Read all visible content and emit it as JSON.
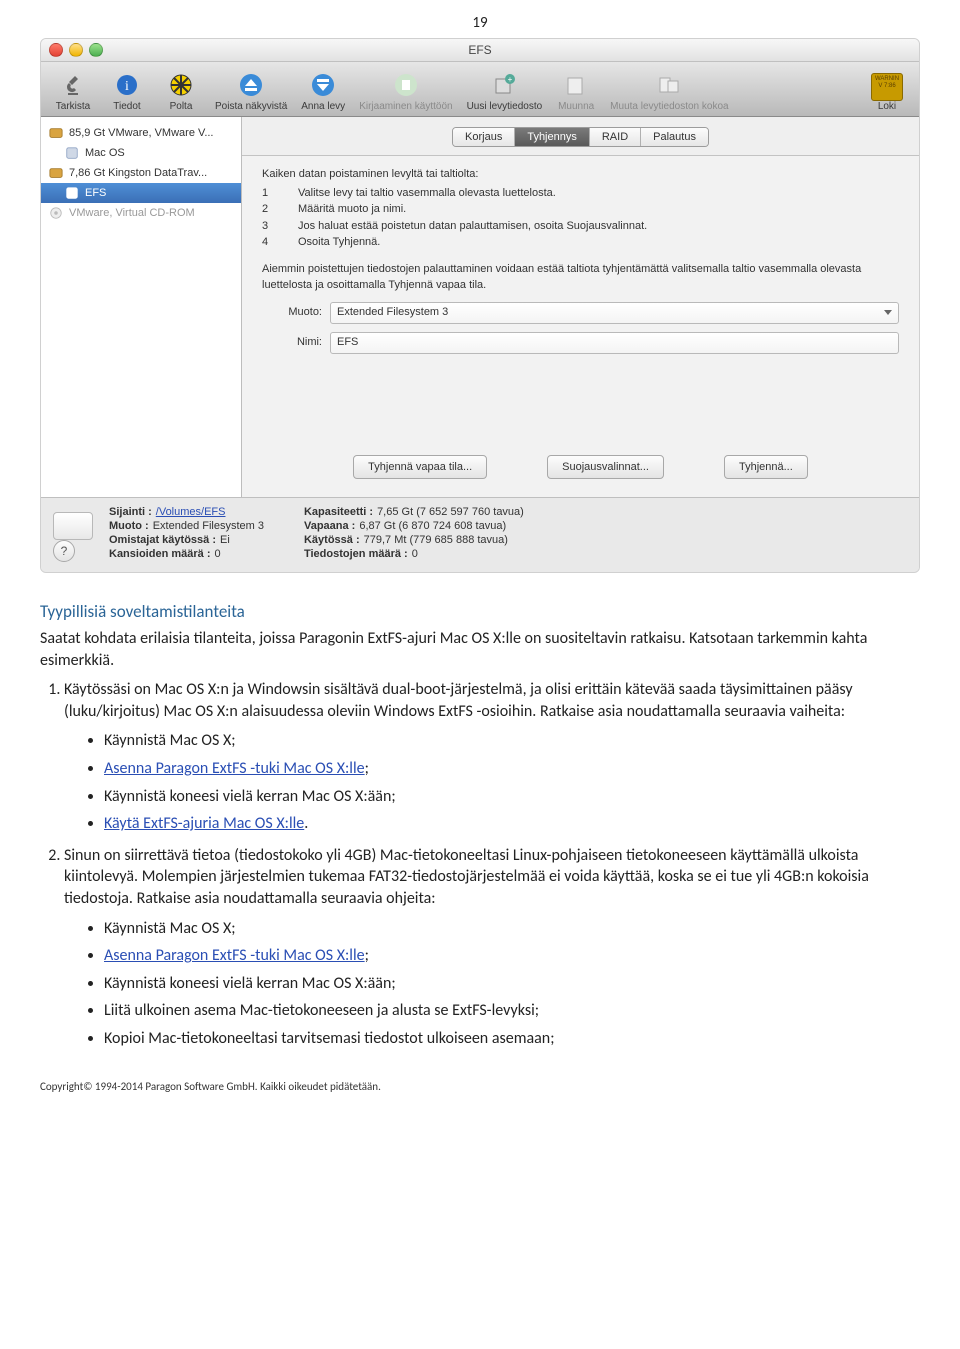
{
  "page_number": "19",
  "screenshot": {
    "window_title": "EFS",
    "toolbar": [
      {
        "label": "Tarkista",
        "dim": false
      },
      {
        "label": "Tiedot",
        "dim": false
      },
      {
        "label": "Polta",
        "dim": false
      },
      {
        "label": "Poista näkyvistä",
        "dim": false
      },
      {
        "label": "Anna levy",
        "dim": false
      },
      {
        "label": "Kirjaaminen käyttöön",
        "dim": true
      },
      {
        "label": "Uusi levytiedosto",
        "dim": false
      },
      {
        "label": "Muunna",
        "dim": true
      },
      {
        "label": "Muuta levytiedoston kokoa",
        "dim": true
      },
      {
        "label_right": "Loki"
      }
    ],
    "sidebar": [
      {
        "label": "85,9 Gt VMware, VMware V...",
        "type": "disk"
      },
      {
        "label": "Mac OS",
        "type": "vol",
        "child": true
      },
      {
        "label": "7,86 Gt Kingston DataTrav...",
        "type": "disk"
      },
      {
        "label": "EFS",
        "type": "vol",
        "child": true,
        "selected": true
      },
      {
        "label": "VMware, Virtual CD-ROM",
        "type": "opt",
        "dim": true
      }
    ],
    "tabs": [
      "Korjaus",
      "Tyhjennys",
      "RAID",
      "Palautus"
    ],
    "selected_tab": "Tyhjennys",
    "instructions_title": "Kaiken datan poistaminen levyltä tai taltiolta:",
    "instructions": [
      "Valitse levy tai taltio vasemmalla olevasta luettelosta.",
      "Määritä muoto ja nimi.",
      "Jos haluat estää poistetun datan palauttamisen, osoita Suojausvalinnat.",
      "Osoita Tyhjennä."
    ],
    "paragraph": "Aiemmin poistettujen tiedostojen palauttaminen voidaan estää taltiota tyhjentämättä valitsemalla taltio vasemmalla olevasta luettelosta ja osoittamalla Tyhjennä vapaa tila.",
    "form": {
      "muoto_label": "Muoto:",
      "muoto_value": "Extended Filesystem 3",
      "nimi_label": "Nimi:",
      "nimi_value": "EFS"
    },
    "buttons": [
      "Tyhjennä vapaa tila...",
      "Suojausvalinnat...",
      "Tyhjennä..."
    ],
    "footer_left": [
      {
        "k": "Sijainti :",
        "v": "/Volumes/EFS",
        "link": true
      },
      {
        "k": "Muoto :",
        "v": "Extended Filesystem 3"
      },
      {
        "k": "Omistajat käytössä :",
        "v": "Ei"
      },
      {
        "k": "Kansioiden määrä :",
        "v": "0"
      }
    ],
    "footer_right": [
      {
        "k": "Kapasiteetti :",
        "v": "7,65 Gt (7 652 597 760 tavua)"
      },
      {
        "k": "Vapaana :",
        "v": "6,87 Gt (6 870 724 608 tavua)"
      },
      {
        "k": "Käytössä :",
        "v": "779,7 Mt (779 685 888 tavua)"
      },
      {
        "k": "Tiedostojen määrä :",
        "v": "0"
      }
    ]
  },
  "doc": {
    "heading": "Tyypillisiä soveltamistilanteita",
    "intro": "Saatat kohdata erilaisia tilanteita, joissa Paragonin ExtFS-ajuri Mac OS X:lle on suositeltavin ratkaisu. Katsotaan tarkemmin kahta esimerkkiä.",
    "item1": {
      "text": "Käytössäsi on Mac OS X:n ja Windowsin sisältävä dual-boot-järjestelmä, ja olisi erittäin kätevää saada täysimittainen pääsy (luku/kirjoitus) Mac OS X:n alaisuudessa oleviin Windows ExtFS -osioihin. Ratkaise asia noudattamalla seuraavia vaiheita:",
      "bullets": [
        {
          "t": "Käynnistä Mac OS X;"
        },
        {
          "t": "Asenna Paragon ExtFS -tuki Mac OS X:lle",
          "link": true,
          "suffix": ";"
        },
        {
          "t": "Käynnistä koneesi vielä kerran Mac OS X:ään;"
        },
        {
          "t": "Käytä ExtFS-ajuria Mac OS X:lle",
          "link": true,
          "suffix": "."
        }
      ]
    },
    "item2": {
      "text": "Sinun on siirrettävä tietoa (tiedostokoko yli 4GB) Mac-tietokoneeltasi Linux-pohjaiseen tietokoneeseen käyttämällä ulkoista kiintolevyä. Molempien järjestelmien tukemaa FAT32-tiedostojärjestelmää ei voida käyttää, koska se ei tue yli 4GB:n kokoisia tiedostoja. Ratkaise asia noudattamalla seuraavia ohjeita:",
      "bullets": [
        {
          "t": "Käynnistä Mac OS X;"
        },
        {
          "t": "Asenna Paragon ExtFS -tuki Mac OS X:lle",
          "link": true,
          "suffix": ";"
        },
        {
          "t": "Käynnistä koneesi vielä kerran Mac OS X:ään;"
        },
        {
          "t": "Liitä ulkoinen asema Mac-tietokoneeseen ja alusta se ExtFS-levyksi;"
        },
        {
          "t": "Kopioi Mac-tietokoneeltasi tarvitsemasi tiedostot ulkoiseen asemaan;"
        }
      ]
    },
    "copyright": "Copyright© 1994-2014 Paragon Software GmbH. Kaikki oikeudet pidätetään."
  }
}
